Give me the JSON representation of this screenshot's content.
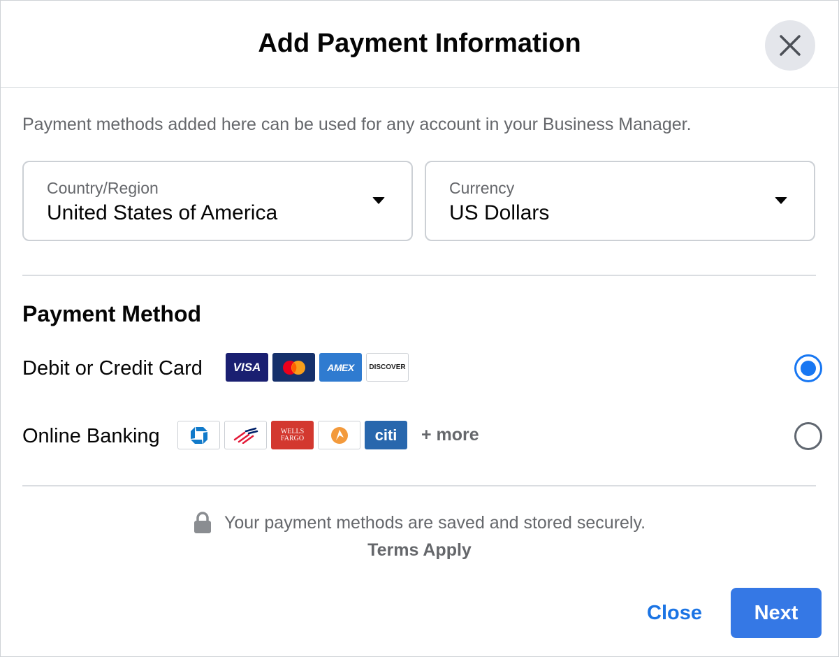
{
  "dialog": {
    "title": "Add Payment Information",
    "intro": "Payment methods added here can be used for any account in your Business Manager."
  },
  "country": {
    "label": "Country/Region",
    "value": "United States of America"
  },
  "currency": {
    "label": "Currency",
    "value": "US Dollars"
  },
  "payment": {
    "section_title": "Payment Method",
    "card": {
      "label": "Debit or Credit Card",
      "selected": true,
      "logos": {
        "visa": "VISA",
        "amex": "AMEX",
        "discover": "DISCOVER"
      }
    },
    "bank": {
      "label": "Online Banking",
      "selected": false,
      "logos": {
        "wells_fargo_1": "WELLS",
        "wells_fargo_2": "FARGO",
        "citi": "citi"
      },
      "more": "+ more"
    }
  },
  "footer": {
    "secure_text": "Your payment methods are saved and stored securely.",
    "terms": "Terms Apply",
    "close_label": "Close",
    "next_label": "Next"
  },
  "colors": {
    "primary": "#1877f2",
    "button": "#3578e5",
    "secondary_text": "#65676b"
  }
}
